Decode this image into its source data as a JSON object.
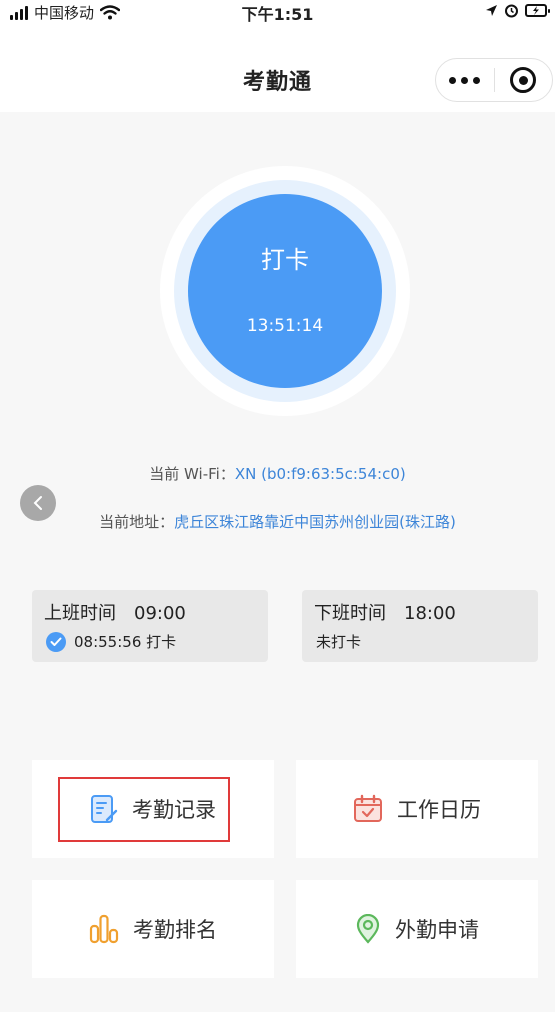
{
  "status_bar": {
    "carrier": "中国移动",
    "time": "下午1:51"
  },
  "nav": {
    "title": "考勤通"
  },
  "punch": {
    "label": "打卡",
    "time": "13:51:14"
  },
  "wifi": {
    "prefix": "当前 Wi-Fi：",
    "value": "XN (b0:f9:63:5c:54:c0)"
  },
  "address": {
    "prefix": "当前地址：",
    "value": "虎丘区珠江路靠近中国苏州创业园(珠江路)"
  },
  "shifts": {
    "on": {
      "label": "上班时间",
      "time": "09:00",
      "status": "08:55:56 打卡",
      "checked": true
    },
    "off": {
      "label": "下班时间",
      "time": "18:00",
      "status": "未打卡",
      "checked": false
    }
  },
  "menu": [
    {
      "label": "考勤记录",
      "icon": "record-icon",
      "color": "#4b9bf5"
    },
    {
      "label": "工作日历",
      "icon": "calendar-icon",
      "color": "#e2675b"
    },
    {
      "label": "考勤排名",
      "icon": "ranking-icon",
      "color": "#f0a02f"
    },
    {
      "label": "外勤申请",
      "icon": "location-icon",
      "color": "#5cb85c"
    }
  ],
  "colors": {
    "accent": "#4b9bf5",
    "link": "#3d85d8",
    "highlight": "#e03a3a"
  }
}
